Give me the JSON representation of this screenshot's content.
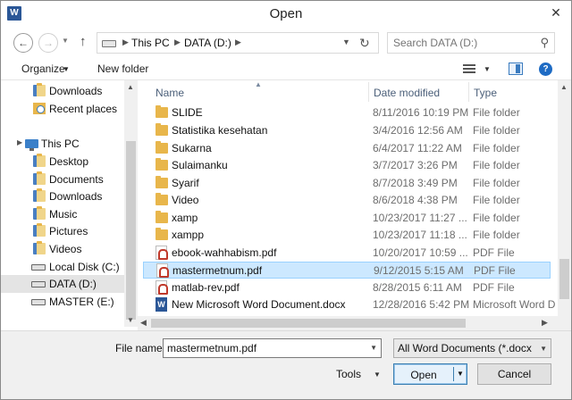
{
  "window": {
    "title": "Open",
    "app_icon": "W",
    "close_glyph": "✕"
  },
  "address": {
    "crumbs": [
      "This PC",
      "DATA (D:)"
    ],
    "search_placeholder": "Search DATA (D:)"
  },
  "toolbar": {
    "organize_label": "Organize",
    "new_folder_label": "New folder"
  },
  "nav_items": [
    {
      "label": "Downloads",
      "icon": "downloads-folder-icon"
    },
    {
      "label": "Recent places",
      "icon": "recent-places-icon"
    },
    {
      "label": "This PC",
      "icon": "this-pc-icon"
    },
    {
      "label": "Desktop",
      "icon": "desktop-folder-icon"
    },
    {
      "label": "Documents",
      "icon": "documents-folder-icon"
    },
    {
      "label": "Downloads",
      "icon": "downloads-folder-icon"
    },
    {
      "label": "Music",
      "icon": "music-folder-icon"
    },
    {
      "label": "Pictures",
      "icon": "pictures-folder-icon"
    },
    {
      "label": "Videos",
      "icon": "videos-folder-icon"
    },
    {
      "label": "Local Disk (C:)",
      "icon": "drive-icon"
    },
    {
      "label": "DATA (D:)",
      "icon": "drive-icon"
    },
    {
      "label": "MASTER (E:)",
      "icon": "drive-icon"
    }
  ],
  "columns": {
    "name": "Name",
    "date": "Date modified",
    "type": "Type"
  },
  "files": [
    {
      "name": "SLIDE",
      "date": "8/11/2016 10:19 PM",
      "type": "File folder",
      "icon": "folder-icon"
    },
    {
      "name": "Statistika kesehatan",
      "date": "3/4/2016 12:56 AM",
      "type": "File folder",
      "icon": "folder-icon"
    },
    {
      "name": "Sukarna",
      "date": "6/4/2017 11:22 AM",
      "type": "File folder",
      "icon": "folder-icon"
    },
    {
      "name": "Sulaimanku",
      "date": "3/7/2017 3:26 PM",
      "type": "File folder",
      "icon": "folder-icon"
    },
    {
      "name": "Syarif",
      "date": "8/7/2018 3:49 PM",
      "type": "File folder",
      "icon": "folder-icon"
    },
    {
      "name": "Video",
      "date": "8/6/2018 4:38 PM",
      "type": "File folder",
      "icon": "folder-icon"
    },
    {
      "name": "xamp",
      "date": "10/23/2017 11:27 ...",
      "type": "File folder",
      "icon": "folder-icon"
    },
    {
      "name": "xampp",
      "date": "10/23/2017 11:18 ...",
      "type": "File folder",
      "icon": "folder-icon"
    },
    {
      "name": "ebook-wahhabism.pdf",
      "date": "10/20/2017 10:59 ...",
      "type": "PDF File",
      "icon": "pdf-file-icon"
    },
    {
      "name": "mastermetnum.pdf",
      "date": "9/12/2015 5:15 AM",
      "type": "PDF File",
      "icon": "pdf-file-icon"
    },
    {
      "name": "matlab-rev.pdf",
      "date": "8/28/2015 6:11 AM",
      "type": "PDF File",
      "icon": "pdf-file-icon"
    },
    {
      "name": "New Microsoft Word Document.docx",
      "date": "12/28/2016 5:42 PM",
      "type": "Microsoft Word D",
      "icon": "word-document-icon"
    }
  ],
  "footer": {
    "file_name_label": "File name:",
    "file_name_value": "mastermetnum.pdf",
    "filter_value": "All Word Documents (*.docx;*.d",
    "tools_label": "Tools",
    "open_label": "Open",
    "cancel_label": "Cancel"
  },
  "colors": {
    "selection_bg": "#cce8ff",
    "selection_border": "#99d1ff",
    "accent": "#1e6bc4"
  }
}
